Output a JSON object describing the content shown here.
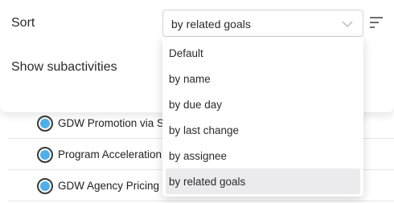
{
  "sort": {
    "label": "Sort",
    "selected_value": "by related goals",
    "options": [
      "Default",
      "by name",
      "by due day",
      "by last change",
      "by assignee",
      "by related goals"
    ],
    "selected_index": 5
  },
  "subactivities": {
    "label": "Show subactivities"
  },
  "activities": [
    {
      "name": "GDW Promotion via Sp"
    },
    {
      "name": "Program Acceleration S"
    },
    {
      "name": "GDW Agency Pricing Li"
    }
  ],
  "colors": {
    "status_dot": "#4fb0e8",
    "selected_option_bg": "#ebebee"
  },
  "icons": {
    "select_arrow": "chevron-down-icon",
    "sort_button": "sort-lines-icon"
  }
}
